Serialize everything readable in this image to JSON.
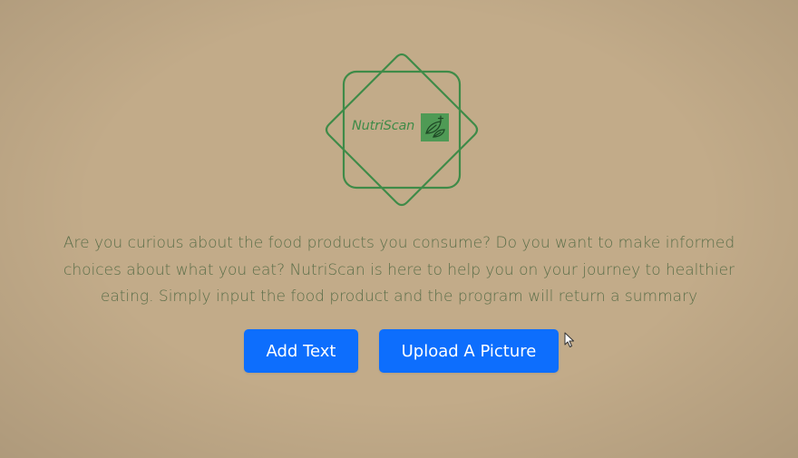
{
  "colors": {
    "background": "#c2ab89",
    "logo_green": "#3f8b48",
    "intro_text": "#5b6e49",
    "button_primary": "#0d6efd",
    "button_text": "#ffffff"
  },
  "logo": {
    "text": "NutriScan",
    "badge_icon": "leaf-scan-icon"
  },
  "intro": {
    "text": "Are you curious about the food products you consume? Do you want to make informed choices about what you eat? NutriScan is here to help you on your journey to healthier eating. Simply input the food product and the program will return a summary"
  },
  "actions": {
    "add_text_label": "Add Text",
    "upload_picture_label": "Upload A Picture"
  },
  "cursor": {
    "icon": "mouse-pointer-icon"
  }
}
